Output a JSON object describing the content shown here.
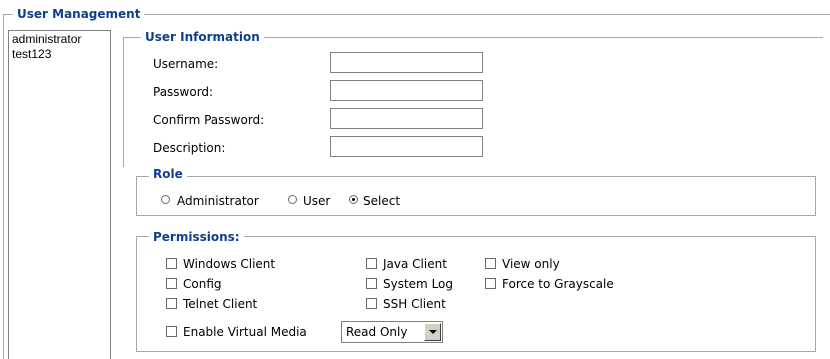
{
  "user_management": {
    "title": "User Management",
    "users": [
      "administrator",
      "test123"
    ]
  },
  "user_information": {
    "title": "User Information",
    "username_label": "Username:",
    "username_value": "",
    "password_label": "Password:",
    "password_value": "",
    "confirm_password_label": "Confirm Password:",
    "confirm_password_value": "",
    "description_label": "Description:",
    "description_value": ""
  },
  "role": {
    "title": "Role",
    "options": [
      {
        "label": "Administrator",
        "checked": false
      },
      {
        "label": "User",
        "checked": false
      },
      {
        "label": "Select",
        "checked": true
      }
    ]
  },
  "permissions": {
    "title": "Permissions:",
    "items": [
      {
        "label": "Windows Client",
        "checked": false
      },
      {
        "label": "Java Client",
        "checked": false
      },
      {
        "label": "View only",
        "checked": false
      },
      {
        "label": "Config",
        "checked": false
      },
      {
        "label": "System Log",
        "checked": false
      },
      {
        "label": "Force to Grayscale",
        "checked": false
      },
      {
        "label": "Telnet Client",
        "checked": false
      },
      {
        "label": "SSH Client",
        "checked": false
      },
      {
        "label": "Enable Virtual Media",
        "checked": false
      }
    ],
    "virtual_media_mode": "Read Only"
  },
  "colors": {
    "legend_text": "#0f3f8f",
    "border": "#a8a8a8"
  }
}
